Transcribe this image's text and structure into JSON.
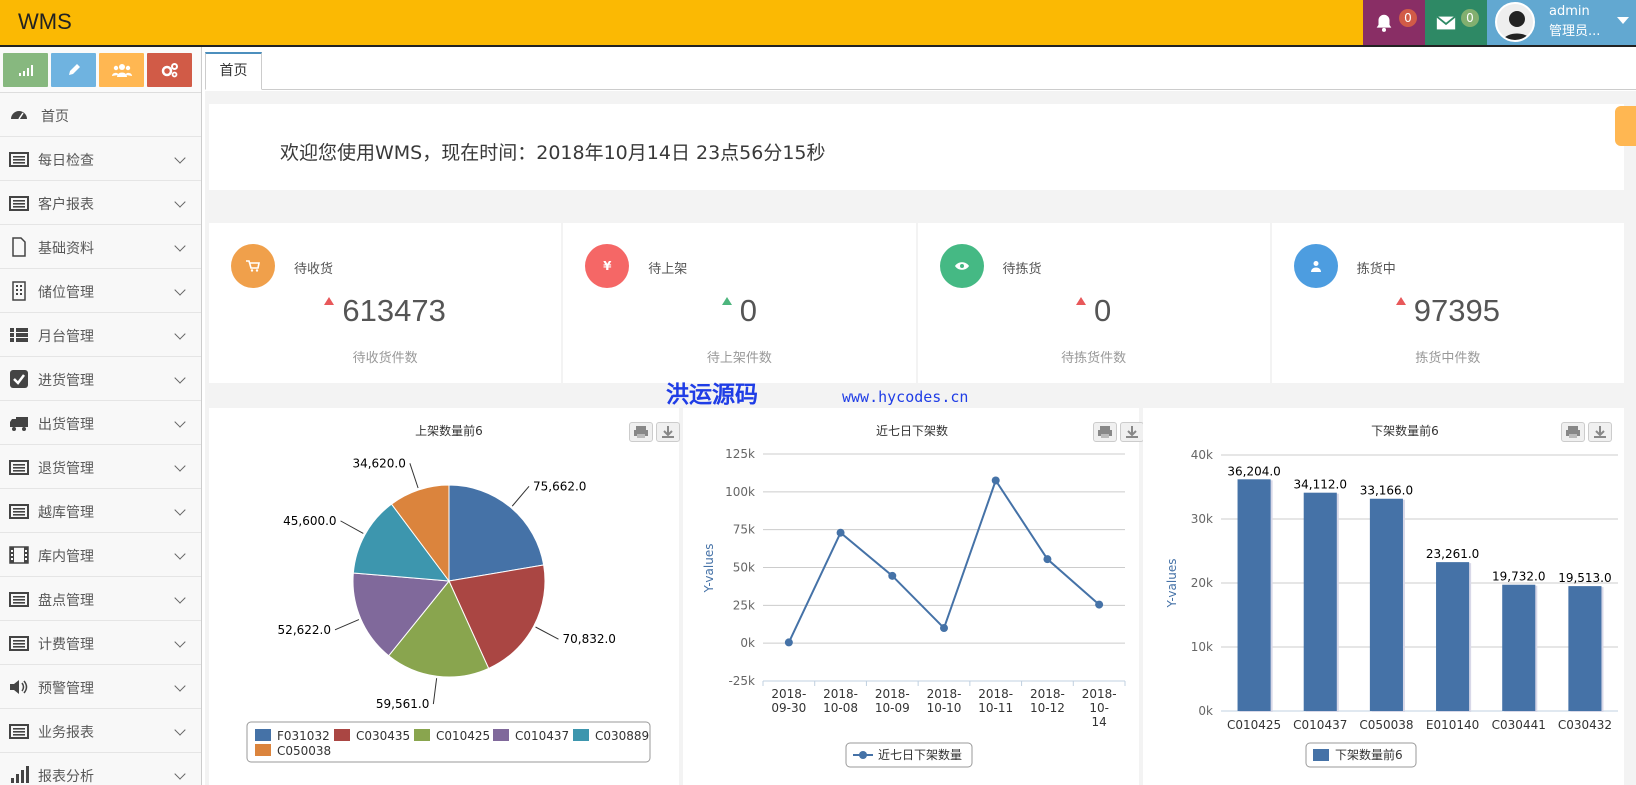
{
  "header": {
    "brand": "WMS",
    "notifications_count": "0",
    "messages_count": "0",
    "user_name": "admin",
    "user_role": "管理员..."
  },
  "sidebar": {
    "items": [
      {
        "label": "首页",
        "icon": "dashboard-icon",
        "expandable": false
      },
      {
        "label": "每日检查",
        "icon": "list-icon",
        "expandable": true
      },
      {
        "label": "客户报表",
        "icon": "list-icon",
        "expandable": true
      },
      {
        "label": "基础资料",
        "icon": "file-icon",
        "expandable": true
      },
      {
        "label": "储位管理",
        "icon": "building-icon",
        "expandable": true
      },
      {
        "label": "月台管理",
        "icon": "list-bullet-icon",
        "expandable": true
      },
      {
        "label": "进货管理",
        "icon": "check-square-icon",
        "expandable": true
      },
      {
        "label": "出货管理",
        "icon": "truck-icon",
        "expandable": true
      },
      {
        "label": "退货管理",
        "icon": "list-icon",
        "expandable": true
      },
      {
        "label": "越库管理",
        "icon": "list-icon",
        "expandable": true
      },
      {
        "label": "库内管理",
        "icon": "film-icon",
        "expandable": true
      },
      {
        "label": "盘点管理",
        "icon": "list-icon",
        "expandable": true
      },
      {
        "label": "计费管理",
        "icon": "list-icon",
        "expandable": true
      },
      {
        "label": "预警管理",
        "icon": "volume-icon",
        "expandable": true
      },
      {
        "label": "业务报表",
        "icon": "list-icon",
        "expandable": true
      },
      {
        "label": "报表分析",
        "icon": "bar-signal-icon",
        "expandable": true
      }
    ]
  },
  "tabs": [
    {
      "label": "首页"
    }
  ],
  "welcome": {
    "text": "欢迎您使用WMS，现在时间：2018年10月14日 23点56分15秒"
  },
  "stats": [
    {
      "title": "待收货",
      "value": "613473",
      "sub": "待收货件数",
      "color": "#F0A04B",
      "icon": "cart-icon",
      "arrow": "red"
    },
    {
      "title": "待上架",
      "value": "0",
      "sub": "待上架件数",
      "color": "#F56766",
      "icon": "yen-icon",
      "arrow": "green"
    },
    {
      "title": "待拣货",
      "value": "0",
      "sub": "待拣货件数",
      "color": "#45B984",
      "icon": "eye-icon",
      "arrow": "red"
    },
    {
      "title": "拣货中",
      "value": "97395",
      "sub": "拣货中件数",
      "color": "#4D9DE0",
      "icon": "user-icon",
      "arrow": "red"
    }
  ],
  "watermark": {
    "text": "洪运源码",
    "url": "www.hycodes.cn"
  },
  "chart_data": [
    {
      "type": "pie",
      "title": "上架数量前6",
      "categories": [
        "F031032",
        "C030435",
        "C010425",
        "C010437",
        "C030889",
        "C050038"
      ],
      "values": [
        75662.0,
        70832.0,
        59561.0,
        52622.0,
        45600.0,
        34620.0
      ],
      "value_labels": [
        "75,662.0",
        "70,832.0",
        "59,561.0",
        "52,622.0",
        "45,600.0",
        "34,620.0"
      ],
      "colors": [
        "#4572A7",
        "#AA4643",
        "#89A54E",
        "#80699B",
        "#3D96AE",
        "#DB843D"
      ],
      "legend": "bottom"
    },
    {
      "type": "line",
      "title": "近七日下架数",
      "categories": [
        "2018-09-30",
        "2018-10-08",
        "2018-10-09",
        "2018-10-10",
        "2018-10-11",
        "2018-10-12",
        "2018-10-14"
      ],
      "category_lines": [
        [
          "2018-",
          "09-30"
        ],
        [
          "2018-",
          "10-08"
        ],
        [
          "2018-",
          "10-09"
        ],
        [
          "2018-",
          "10-10"
        ],
        [
          "2018-",
          "10-11"
        ],
        [
          "2018-",
          "10-12"
        ],
        [
          "2018-",
          "10-",
          "14"
        ]
      ],
      "series": [
        {
          "name": "近七日下架数量",
          "values": [
            500,
            73000,
            44500,
            10000,
            107500,
            55500,
            25500
          ]
        }
      ],
      "ylabel": "Y-values",
      "yticks": [
        -25000,
        0,
        25000,
        50000,
        75000,
        100000,
        125000
      ],
      "ytick_labels": [
        "-25k",
        "0k",
        "25k",
        "50k",
        "75k",
        "100k",
        "125k"
      ],
      "ylim": [
        -25000,
        125000
      ],
      "color": "#4572A7",
      "grid": true,
      "legend": "bottom"
    },
    {
      "type": "bar",
      "title": "下架数量前6",
      "categories": [
        "C010425",
        "C010437",
        "C050038",
        "E010140",
        "C030441",
        "C030432"
      ],
      "series": [
        {
          "name": "下架数量前6",
          "values": [
            36204.0,
            34112.0,
            33166.0,
            23261.0,
            19732.0,
            19513.0
          ]
        }
      ],
      "value_labels": [
        "36,204.0",
        "34,112.0",
        "33,166.0",
        "23,261.0",
        "19,732.0",
        "19,513.0"
      ],
      "ylabel": "Y-values",
      "yticks": [
        0,
        10000,
        20000,
        30000,
        40000
      ],
      "ytick_labels": [
        "0k",
        "10k",
        "20k",
        "30k",
        "40k"
      ],
      "ylim": [
        0,
        40000
      ],
      "color": "#4572A7",
      "grid": true,
      "legend": "bottom"
    }
  ]
}
